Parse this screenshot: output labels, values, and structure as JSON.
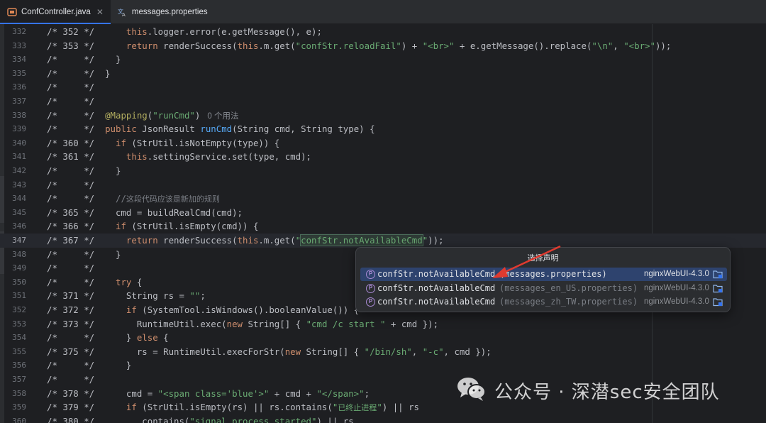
{
  "tabs": [
    {
      "label": "ConfController.java",
      "icon": "java-class-icon",
      "active": true
    },
    {
      "label": "messages.properties",
      "icon": "translation-icon",
      "active": false
    }
  ],
  "lines": [
    {
      "num": "332",
      "html": "/* 352 */      <span class=\"k\">this</span>.logger.error(e.getMessage(), e);"
    },
    {
      "num": "333",
      "html": "/* 353 */      <span class=\"k\">return</span> renderSuccess(<span class=\"k\">this</span>.m.get(<span class=\"s\">\"confStr.reloadFail\"</span>) + <span class=\"s\">\"&lt;br&gt;\"</span> + e.getMessage().replace(<span class=\"s\">\"\\n\"</span>, <span class=\"s\">\"&lt;br&gt;\"</span>));"
    },
    {
      "num": "334",
      "html": "/*     */    }"
    },
    {
      "num": "335",
      "html": "/*     */  }"
    },
    {
      "num": "336",
      "html": "/*     */"
    },
    {
      "num": "337",
      "html": "/*     */"
    },
    {
      "num": "338",
      "html": "/*     */  <span class=\"a\">@Mapping</span>(<span class=\"s\">\"runCmd\"</span>)<span class=\"hint\">0 个用法</span>"
    },
    {
      "num": "339",
      "html": "/*     */  <span class=\"k\">public</span> JsonResult <span class=\"f\">runCmd</span>(String cmd, String type) {"
    },
    {
      "num": "340",
      "html": "/* 360 */    <span class=\"k\">if</span> (StrUtil.isNotEmpty(type)) {"
    },
    {
      "num": "341",
      "html": "/* 361 */      <span class=\"k\">this</span>.settingService.set(type, cmd);"
    },
    {
      "num": "342",
      "html": "/*     */    }"
    },
    {
      "num": "343",
      "html": "/*     */"
    },
    {
      "num": "344",
      "html": "/*     */    <span class=\"c\">//<span class=\"cn\">这段代码应该是新加的规则</span></span>"
    },
    {
      "num": "345",
      "html": "/* 365 */    cmd = buildRealCmd(cmd);"
    },
    {
      "num": "346",
      "html": "/* 366 */    <span class=\"k\">if</span> (StrUtil.isEmpty(cmd)) {"
    },
    {
      "num": "347",
      "html": "/* 367 */      <span class=\"k\">return</span> renderSuccess(<span class=\"k\">this</span>.m.get(<span class=\"s\">\"<span class=\"hl\">confStr.notAvailableCmd</span>\"</span>));",
      "current": true
    },
    {
      "num": "348",
      "html": "/*     */    }"
    },
    {
      "num": "349",
      "html": "/*     */"
    },
    {
      "num": "350",
      "html": "/*     */    <span class=\"k\">try</span> {"
    },
    {
      "num": "351",
      "html": "/* 371 */      String rs = <span class=\"s\">\"\"</span>;"
    },
    {
      "num": "352",
      "html": "/* 372 */      <span class=\"k\">if</span> (SystemTool.isWindows().booleanValue()) {"
    },
    {
      "num": "353",
      "html": "/* 373 */        RuntimeUtil.exec(<span class=\"k\">new</span> String[] { <span class=\"s\">\"cmd /c start \"</span> + cmd });"
    },
    {
      "num": "354",
      "html": "/*     */      } <span class=\"k\">else</span> {"
    },
    {
      "num": "355",
      "html": "/* 375 */        rs = RuntimeUtil.execForStr(<span class=\"k\">new</span> String[] { <span class=\"s\">\"/bin/sh\"</span>, <span class=\"s\">\"-c\"</span>, cmd });"
    },
    {
      "num": "356",
      "html": "/*     */      }"
    },
    {
      "num": "357",
      "html": "/*     */"
    },
    {
      "num": "358",
      "html": "/* 378 */      cmd = <span class=\"s\">\"&lt;span class='blue'&gt;\"</span> + cmd + <span class=\"s\">\"&lt;/span&gt;\"</span>;"
    },
    {
      "num": "359",
      "html": "/* 379 */      <span class=\"k\">if</span> (StrUtil.isEmpty(rs) || rs.contains(<span class=\"s\">\"<span class=\"cn\">已终止进程</span>\"</span>) || rs"
    },
    {
      "num": "360",
      "html": "/* 380 */        .contains(<span class=\"s\">\"signal process started\"</span>) || rs"
    }
  ],
  "popup": {
    "title": "选择声明",
    "items": [
      {
        "name": "confStr.notAvailableCmd",
        "file": "(messages.properties)",
        "module": "nginxWebUI-4.3.0",
        "selected": true
      },
      {
        "name": "confStr.notAvailableCmd",
        "file": "(messages_en_US.properties)",
        "module": "nginxWebUI-4.3.0",
        "selected": false
      },
      {
        "name": "confStr.notAvailableCmd",
        "file": "(messages_zh_TW.properties)",
        "module": "nginxWebUI-4.3.0",
        "selected": false
      }
    ]
  },
  "watermark": {
    "text": "公众号 · 深潜sec安全团队",
    "icon": "wechat-icon"
  },
  "colors": {
    "arrow": "#e03a2f",
    "accent": "#3574f0",
    "selection": "#2e436e"
  }
}
